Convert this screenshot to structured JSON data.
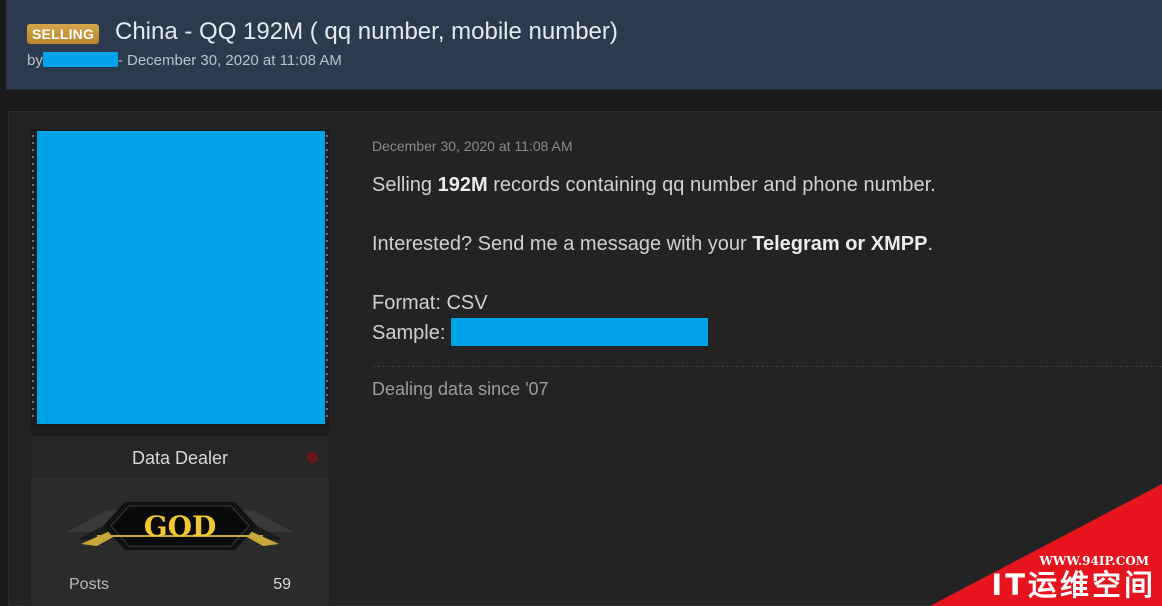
{
  "thread": {
    "badge": "SELLING",
    "title": "China - QQ 192M ( qq number, mobile number)",
    "by_prefix": "by",
    "meta_suffix": "- December 30, 2020 at 11:08 AM"
  },
  "user": {
    "role": "Data Dealer",
    "rank_text": "GOD",
    "stats": {
      "posts_label": "Posts",
      "posts_value": "59"
    }
  },
  "post": {
    "date": "December 30, 2020 at 11:08 AM",
    "line1_pre": "Selling ",
    "line1_bold": "192M",
    "line1_post": " records containing qq number and phone number.",
    "line2_pre": "Interested? Send me a message with your ",
    "line2_bold": "Telegram or XMPP",
    "line2_post": ".",
    "format_line": "Format: CSV",
    "sample_label": "Sample: ",
    "signature": "Dealing data since '07"
  },
  "watermark": {
    "url": "WWW.94IP.COM",
    "brand": "IT运维空间"
  },
  "colors": {
    "header_bg": "#2b3a4d",
    "badge_gold": "#c9973b",
    "redaction": "#00a2e8",
    "watermark_red": "#e5141e"
  }
}
